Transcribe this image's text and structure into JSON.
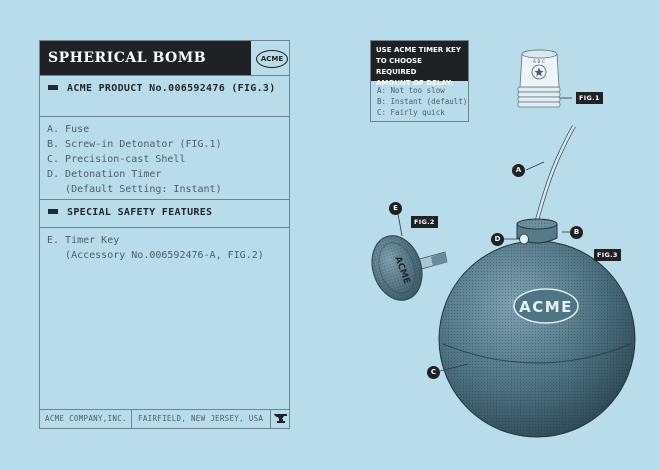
{
  "sheet": {
    "title": "SPHERICAL BOMB",
    "logo": "ACME",
    "product_line": "ACME PRODUCT No.006592476 (FIG.3)",
    "parts": [
      "A. Fuse",
      "B. Screw-in Detonator (FIG.1)",
      "C. Precision-cast Shell",
      "D. Detonation Timer",
      "   (Default Setting: Instant)"
    ],
    "safety_heading": "SPECIAL SAFETY FEATURES",
    "safety_items": [
      "E. Timer Key",
      "   (Accessory No.006592476-A, FIG.2)"
    ],
    "footer_company": "ACME COMPANY,INC.",
    "footer_location": "FAIRFIELD, NEW JERSEY, USA"
  },
  "timer_key": {
    "heading": [
      "USE ACME TIMER KEY",
      "TO CHOOSE REQUIRED",
      "AMOUNT OF DELAY:"
    ],
    "options": [
      "A: Not too slow",
      "B: Instant (default)",
      "C: Fairly quick"
    ]
  },
  "figures": {
    "fig1": "FIG.1",
    "fig2": "FIG.2",
    "fig3": "FIG.3",
    "detonator_letters": "A B C",
    "bomb_logo": "ACME",
    "key_logo": "ACME"
  },
  "callouts": {
    "a": "A",
    "b": "B",
    "c": "C",
    "d": "D",
    "e": "E"
  },
  "colors": {
    "background": "#b9dcea",
    "ink": "#1e2224",
    "bomb": "#4f7585"
  }
}
